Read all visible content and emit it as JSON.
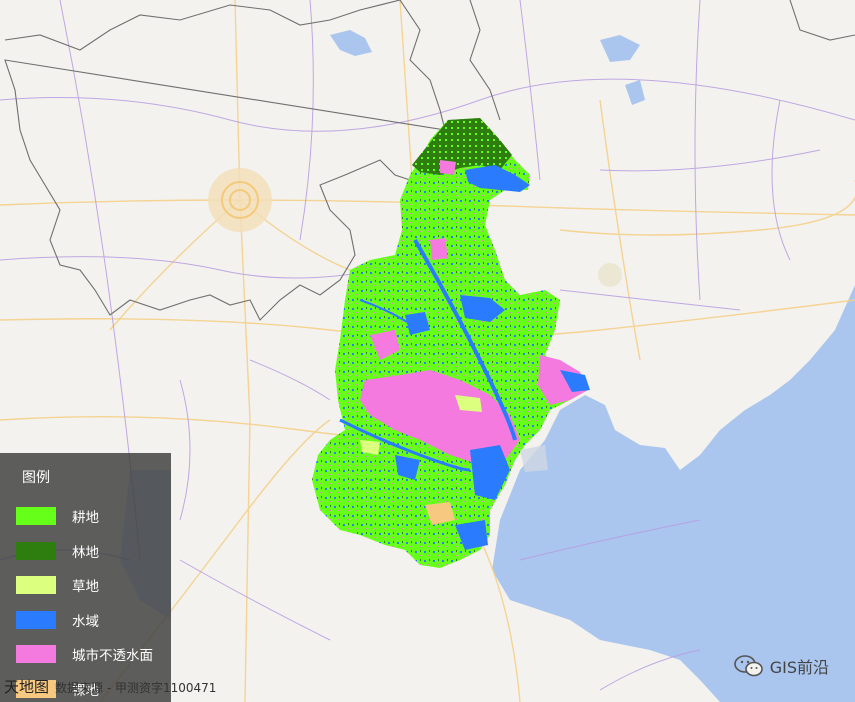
{
  "colors": {
    "background": "#f3f2ee",
    "sea": "#aac6ee",
    "cultivated": "#66ff1a",
    "forest": "#2e7d0f",
    "grass": "#dcff80",
    "water": "#2b7bff",
    "urban": "#f57adf",
    "bare": "#f7c87f"
  },
  "legend": {
    "title": "图例",
    "items": [
      {
        "label": "耕地",
        "color": "#66ff1a"
      },
      {
        "label": "林地",
        "color": "#2e7d0f"
      },
      {
        "label": "草地",
        "color": "#dcff80"
      },
      {
        "label": "水域",
        "color": "#2b7bff"
      },
      {
        "label": "城市不透水面",
        "color": "#f57adf"
      },
      {
        "label": "裸地",
        "color": "#f7c87f"
      }
    ]
  },
  "attribution": {
    "logo_text": "天地图",
    "text": "数据来源 - 甲测资字1100471"
  },
  "watermark": {
    "text": "GIS前沿",
    "icon": "wechat-icon"
  }
}
